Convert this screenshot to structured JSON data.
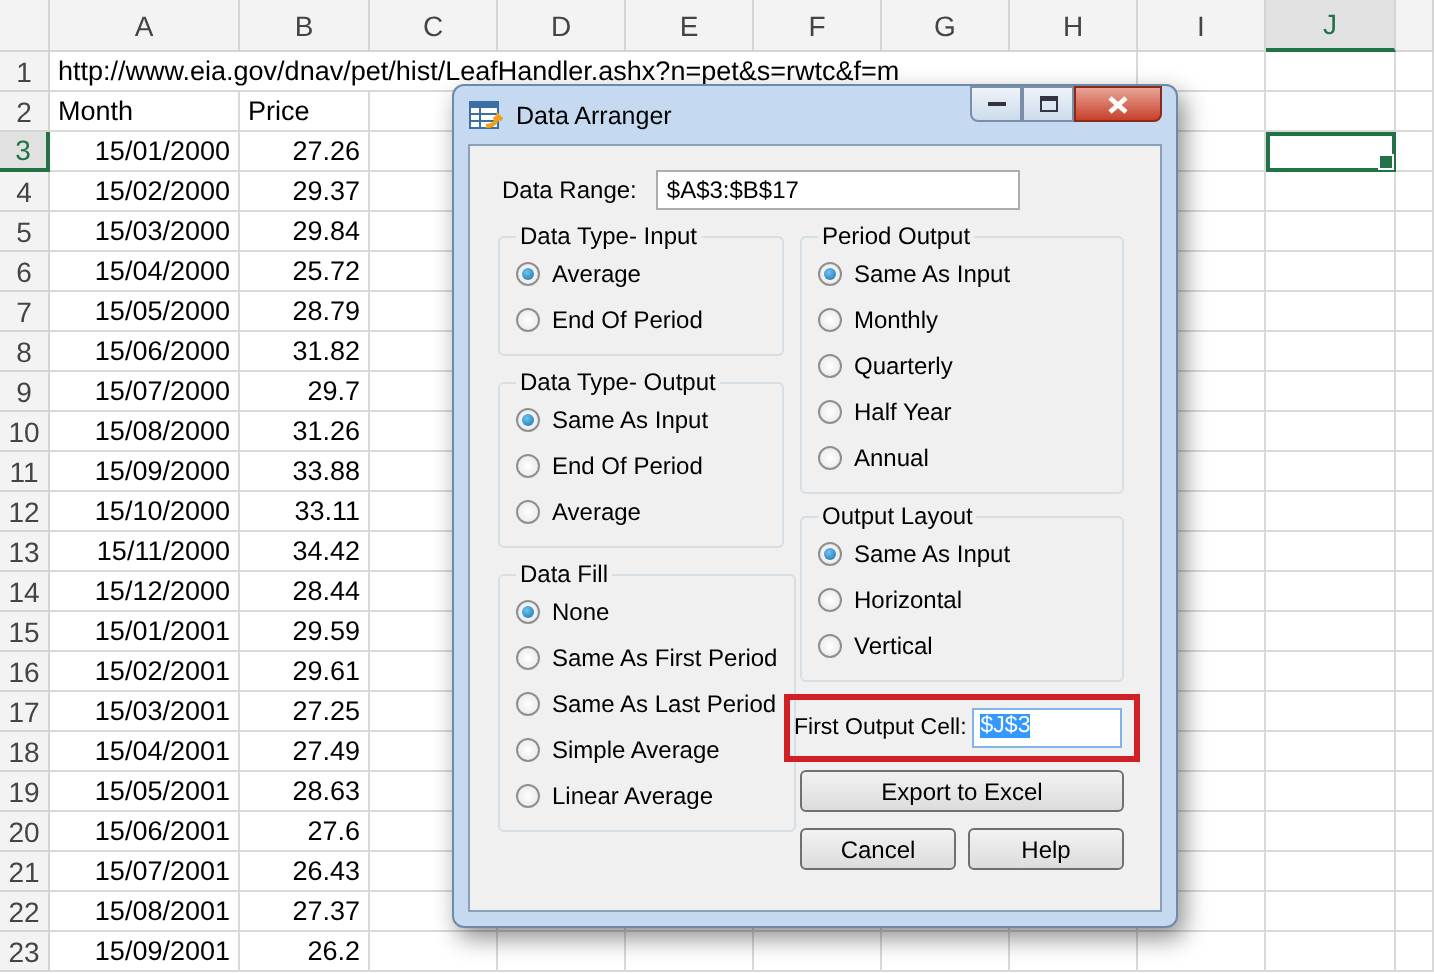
{
  "spreadsheet": {
    "columns": [
      {
        "label": "A",
        "selected": false
      },
      {
        "label": "B",
        "selected": false
      },
      {
        "label": "C",
        "selected": false
      },
      {
        "label": "D",
        "selected": false
      },
      {
        "label": "E",
        "selected": false
      },
      {
        "label": "F",
        "selected": false
      },
      {
        "label": "G",
        "selected": false
      },
      {
        "label": "H",
        "selected": false
      },
      {
        "label": "I",
        "selected": false
      },
      {
        "label": "J",
        "selected": true
      }
    ],
    "rows": [
      {
        "number": "1",
        "selected": false,
        "cells": [
          {
            "text": "http://www.eia.gov/dnav/pet/hist/LeafHandler.ashx?n=pet&s=rwtc&f=m",
            "kind": "text"
          }
        ]
      },
      {
        "number": "2",
        "selected": false,
        "cells": [
          {
            "text": "Month",
            "kind": "text"
          },
          {
            "text": "Price",
            "kind": "text"
          }
        ]
      },
      {
        "number": "3",
        "selected": true,
        "cells": [
          {
            "text": "15/01/2000",
            "kind": "number"
          },
          {
            "text": "27.26",
            "kind": "number"
          }
        ]
      },
      {
        "number": "4",
        "selected": false,
        "cells": [
          {
            "text": "15/02/2000",
            "kind": "number"
          },
          {
            "text": "29.37",
            "kind": "number"
          }
        ]
      },
      {
        "number": "5",
        "selected": false,
        "cells": [
          {
            "text": "15/03/2000",
            "kind": "number"
          },
          {
            "text": "29.84",
            "kind": "number"
          }
        ]
      },
      {
        "number": "6",
        "selected": false,
        "cells": [
          {
            "text": "15/04/2000",
            "kind": "number"
          },
          {
            "text": "25.72",
            "kind": "number"
          }
        ]
      },
      {
        "number": "7",
        "selected": false,
        "cells": [
          {
            "text": "15/05/2000",
            "kind": "number"
          },
          {
            "text": "28.79",
            "kind": "number"
          }
        ]
      },
      {
        "number": "8",
        "selected": false,
        "cells": [
          {
            "text": "15/06/2000",
            "kind": "number"
          },
          {
            "text": "31.82",
            "kind": "number"
          }
        ]
      },
      {
        "number": "9",
        "selected": false,
        "cells": [
          {
            "text": "15/07/2000",
            "kind": "number"
          },
          {
            "text": "29.7",
            "kind": "number"
          }
        ]
      },
      {
        "number": "10",
        "selected": false,
        "cells": [
          {
            "text": "15/08/2000",
            "kind": "number"
          },
          {
            "text": "31.26",
            "kind": "number"
          }
        ]
      },
      {
        "number": "11",
        "selected": false,
        "cells": [
          {
            "text": "15/09/2000",
            "kind": "number"
          },
          {
            "text": "33.88",
            "kind": "number"
          }
        ]
      },
      {
        "number": "12",
        "selected": false,
        "cells": [
          {
            "text": "15/10/2000",
            "kind": "number"
          },
          {
            "text": "33.11",
            "kind": "number"
          }
        ]
      },
      {
        "number": "13",
        "selected": false,
        "cells": [
          {
            "text": "15/11/2000",
            "kind": "number"
          },
          {
            "text": "34.42",
            "kind": "number"
          }
        ]
      },
      {
        "number": "14",
        "selected": false,
        "cells": [
          {
            "text": "15/12/2000",
            "kind": "number"
          },
          {
            "text": "28.44",
            "kind": "number"
          }
        ]
      },
      {
        "number": "15",
        "selected": false,
        "cells": [
          {
            "text": "15/01/2001",
            "kind": "number"
          },
          {
            "text": "29.59",
            "kind": "number"
          }
        ]
      },
      {
        "number": "16",
        "selected": false,
        "cells": [
          {
            "text": "15/02/2001",
            "kind": "number"
          },
          {
            "text": "29.61",
            "kind": "number"
          }
        ]
      },
      {
        "number": "17",
        "selected": false,
        "cells": [
          {
            "text": "15/03/2001",
            "kind": "number"
          },
          {
            "text": "27.25",
            "kind": "number"
          }
        ]
      },
      {
        "number": "18",
        "selected": false,
        "cells": [
          {
            "text": "15/04/2001",
            "kind": "number"
          },
          {
            "text": "27.49",
            "kind": "number"
          }
        ]
      },
      {
        "number": "19",
        "selected": false,
        "cells": [
          {
            "text": "15/05/2001",
            "kind": "number"
          },
          {
            "text": "28.63",
            "kind": "number"
          }
        ]
      },
      {
        "number": "20",
        "selected": false,
        "cells": [
          {
            "text": "15/06/2001",
            "kind": "number"
          },
          {
            "text": "27.6",
            "kind": "number"
          }
        ]
      },
      {
        "number": "21",
        "selected": false,
        "cells": [
          {
            "text": "15/07/2001",
            "kind": "number"
          },
          {
            "text": "26.43",
            "kind": "number"
          }
        ]
      },
      {
        "number": "22",
        "selected": false,
        "cells": [
          {
            "text": "15/08/2001",
            "kind": "number"
          },
          {
            "text": "27.37",
            "kind": "number"
          }
        ]
      },
      {
        "number": "23",
        "selected": false,
        "cells": [
          {
            "text": "15/09/2001",
            "kind": "number"
          },
          {
            "text": "26.2",
            "kind": "number"
          }
        ]
      }
    ]
  },
  "dialog": {
    "title": "Data Arranger",
    "data_range": {
      "label": "Data Range:",
      "value": "$A$3:$B$17"
    },
    "left_groups": [
      {
        "title": "Data Type- Input",
        "options": [
          {
            "label": "Average",
            "selected": true
          },
          {
            "label": "End Of Period",
            "selected": false
          }
        ]
      },
      {
        "title": "Data Type- Output",
        "options": [
          {
            "label": "Same As Input",
            "selected": true
          },
          {
            "label": "End Of Period",
            "selected": false
          },
          {
            "label": "Average",
            "selected": false
          }
        ]
      },
      {
        "title": "Data Fill",
        "options": [
          {
            "label": "None",
            "selected": true
          },
          {
            "label": "Same As First Period",
            "selected": false
          },
          {
            "label": "Same As Last Period",
            "selected": false
          },
          {
            "label": "Simple Average",
            "selected": false
          },
          {
            "label": "Linear Average",
            "selected": false
          }
        ]
      }
    ],
    "right_groups": [
      {
        "title": "Period Output",
        "options": [
          {
            "label": "Same As Input",
            "selected": true
          },
          {
            "label": "Monthly",
            "selected": false
          },
          {
            "label": "Quarterly",
            "selected": false
          },
          {
            "label": "Half Year",
            "selected": false
          },
          {
            "label": "Annual",
            "selected": false
          }
        ]
      },
      {
        "title": "Output Layout",
        "options": [
          {
            "label": "Same As Input",
            "selected": true
          },
          {
            "label": "Horizontal",
            "selected": false
          },
          {
            "label": "Vertical",
            "selected": false
          }
        ]
      }
    ],
    "first_output_cell": {
      "label": "First Output Cell:",
      "value": "$J$3",
      "highlighted": true,
      "text_selected": true
    },
    "export_button": "Export to Excel",
    "buttons": [
      "Cancel",
      "Help"
    ]
  }
}
